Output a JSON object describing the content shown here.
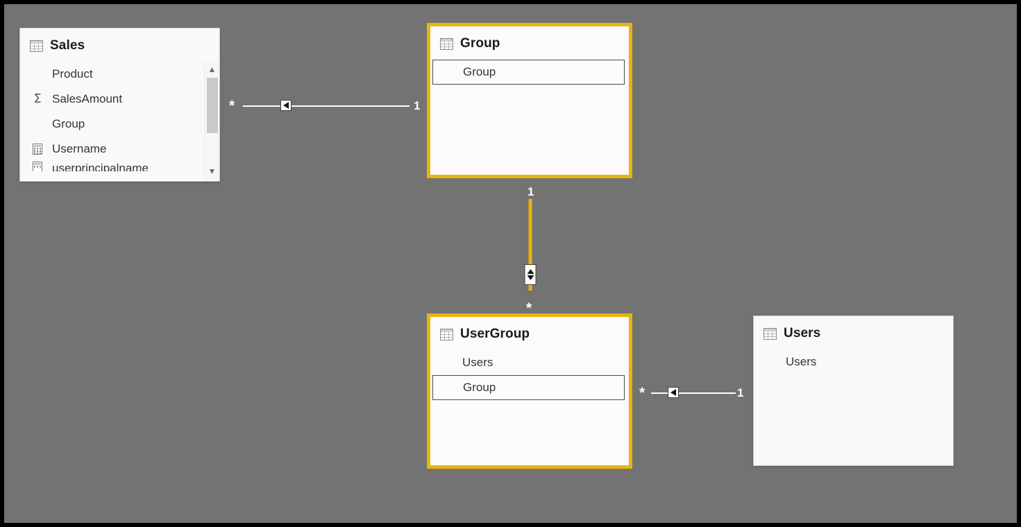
{
  "canvas": {
    "background_color": "#737373",
    "frame_color": "#000000",
    "selection_color": "#e8b409",
    "relationship_line_color": "#ffffff",
    "relationship_highlight_color": "#eab308"
  },
  "tables": [
    {
      "id": "sales",
      "name": "Sales",
      "icon": "table-icon",
      "selected": false,
      "has_scrollbar": true,
      "fields": [
        {
          "name": "Product",
          "icon": "none",
          "highlighted": false
        },
        {
          "name": "SalesAmount",
          "icon": "sigma-icon",
          "highlighted": false
        },
        {
          "name": "Group",
          "icon": "none",
          "highlighted": false
        },
        {
          "name": "Username",
          "icon": "calculator-icon",
          "highlighted": false
        },
        {
          "name": "userprincipalname",
          "icon": "calculator-icon",
          "highlighted": false,
          "clipped": true
        }
      ]
    },
    {
      "id": "group",
      "name": "Group",
      "icon": "table-icon",
      "selected": true,
      "has_scrollbar": false,
      "fields": [
        {
          "name": "Group",
          "icon": "none",
          "highlighted": true
        }
      ]
    },
    {
      "id": "usergroup",
      "name": "UserGroup",
      "icon": "table-icon",
      "selected": true,
      "has_scrollbar": false,
      "fields": [
        {
          "name": "Users",
          "icon": "none",
          "highlighted": false
        },
        {
          "name": "Group",
          "icon": "none",
          "highlighted": true
        }
      ]
    },
    {
      "id": "users",
      "name": "Users",
      "icon": "table-icon",
      "selected": false,
      "has_scrollbar": false,
      "fields": [
        {
          "name": "Users",
          "icon": "none",
          "highlighted": false
        }
      ]
    }
  ],
  "relationships": [
    {
      "id": "sales-group",
      "from_table": "Sales",
      "to_table": "Group",
      "from_cardinality": "*",
      "to_cardinality": "1",
      "cross_filter": "single",
      "highlighted": false
    },
    {
      "id": "group-usergroup",
      "from_table": "Group",
      "to_table": "UserGroup",
      "from_cardinality": "1",
      "to_cardinality": "*",
      "cross_filter": "both",
      "highlighted": true
    },
    {
      "id": "usergroup-users",
      "from_table": "UserGroup",
      "to_table": "Users",
      "from_cardinality": "*",
      "to_cardinality": "1",
      "cross_filter": "single",
      "highlighted": false
    }
  ],
  "scrollbar": {
    "up_arrow": "chevron-up-icon",
    "down_arrow": "chevron-down-icon"
  }
}
